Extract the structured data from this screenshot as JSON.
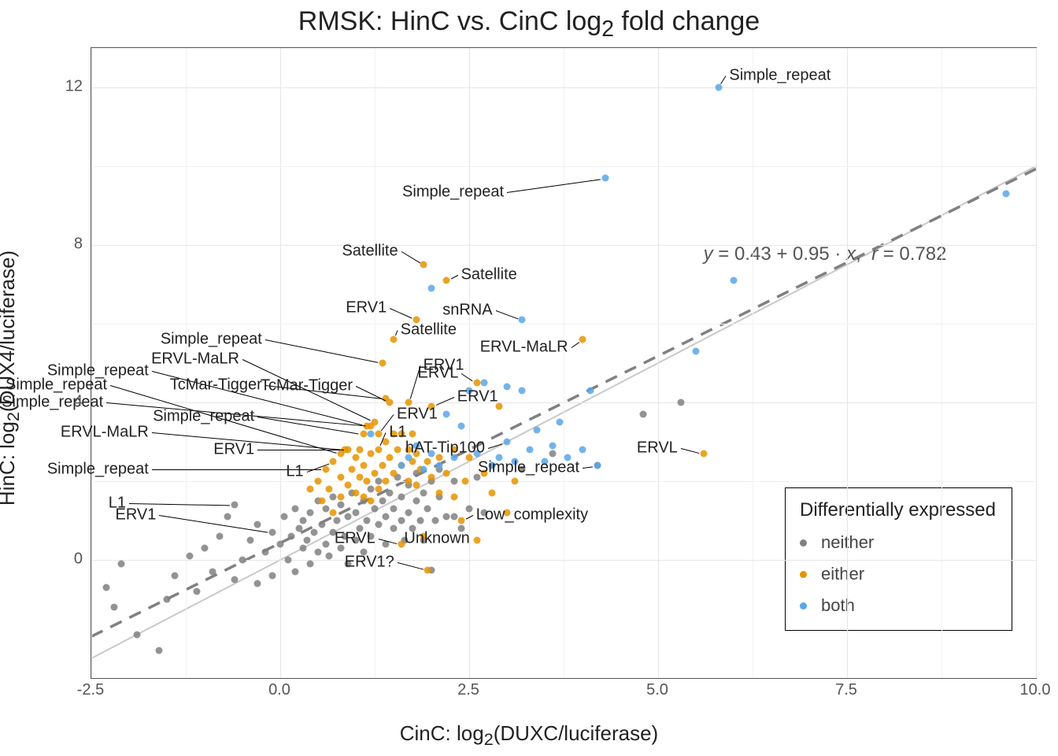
{
  "chart_data": {
    "type": "scatter",
    "title": "RMSK: HinC vs. CinC log2 fold change",
    "xlabel": "CinC: log2(DUXC/luciferase)",
    "ylabel": "HinC: log2(DUX4/luciferase)",
    "xlim": [
      -2.5,
      10.0
    ],
    "ylim": [
      -3.0,
      13.0
    ],
    "x_ticks": [
      -2.5,
      0.0,
      2.5,
      5.0,
      7.5,
      10.0
    ],
    "y_ticks": [
      0,
      4,
      8,
      12
    ],
    "equation": "y = 0.43 + 0.95 · x,  r = 0.782",
    "legend_title": "Differentially expressed",
    "legend_items": [
      {
        "key": "neither",
        "label": "neither",
        "color": "#808080"
      },
      {
        "key": "either",
        "label": "either",
        "color": "#e59400"
      },
      {
        "key": "both",
        "label": "both",
        "color": "#5aa6e6"
      }
    ],
    "regression": {
      "intercept": 0.43,
      "slope": 0.95
    },
    "series": [
      {
        "name": "neither",
        "points": [
          {
            "x": -2.2,
            "y": -1.2
          },
          {
            "x": -2.3,
            "y": -0.7
          },
          {
            "x": -2.1,
            "y": -0.1
          },
          {
            "x": -1.9,
            "y": -1.9
          },
          {
            "x": -1.6,
            "y": -2.3
          },
          {
            "x": -1.5,
            "y": -1.0
          },
          {
            "x": -1.4,
            "y": -0.4
          },
          {
            "x": -1.2,
            "y": 0.1
          },
          {
            "x": -1.1,
            "y": -0.8
          },
          {
            "x": -1.0,
            "y": 0.3
          },
          {
            "x": -0.9,
            "y": -0.3
          },
          {
            "x": -0.8,
            "y": 0.6
          },
          {
            "x": -0.7,
            "y": 1.1
          },
          {
            "x": -0.6,
            "y": -0.5
          },
          {
            "x": -0.6,
            "y": 1.4
          },
          {
            "x": -0.5,
            "y": 0.0
          },
          {
            "x": -0.4,
            "y": 0.5
          },
          {
            "x": -0.3,
            "y": -0.6
          },
          {
            "x": -0.3,
            "y": 0.9
          },
          {
            "x": -0.2,
            "y": 0.2
          },
          {
            "x": -0.1,
            "y": 0.7
          },
          {
            "x": -0.1,
            "y": -0.4
          },
          {
            "x": 0.0,
            "y": 0.4
          },
          {
            "x": 0.05,
            "y": 1.1
          },
          {
            "x": 0.1,
            "y": 0.0
          },
          {
            "x": 0.15,
            "y": 0.6
          },
          {
            "x": 0.2,
            "y": 1.3
          },
          {
            "x": 0.2,
            "y": -0.3
          },
          {
            "x": 0.25,
            "y": 0.8
          },
          {
            "x": 0.3,
            "y": 0.3
          },
          {
            "x": 0.3,
            "y": 1.0
          },
          {
            "x": 0.35,
            "y": 0.5
          },
          {
            "x": 0.4,
            "y": 1.2
          },
          {
            "x": 0.4,
            "y": -0.1
          },
          {
            "x": 0.45,
            "y": 0.7
          },
          {
            "x": 0.5,
            "y": 1.5
          },
          {
            "x": 0.5,
            "y": 0.2
          },
          {
            "x": 0.55,
            "y": 0.9
          },
          {
            "x": 0.6,
            "y": 0.4
          },
          {
            "x": 0.6,
            "y": 1.3
          },
          {
            "x": 0.65,
            "y": 0.1
          },
          {
            "x": 0.7,
            "y": 0.7
          },
          {
            "x": 0.7,
            "y": 1.6
          },
          {
            "x": 0.75,
            "y": 1.0
          },
          {
            "x": 0.8,
            "y": 0.3
          },
          {
            "x": 0.8,
            "y": 1.4
          },
          {
            "x": 0.85,
            "y": 0.6
          },
          {
            "x": 0.9,
            "y": 1.1
          },
          {
            "x": 0.9,
            "y": -0.1
          },
          {
            "x": 0.95,
            "y": 1.7
          },
          {
            "x": 1.0,
            "y": 0.5
          },
          {
            "x": 1.0,
            "y": 1.2
          },
          {
            "x": 1.05,
            "y": 0.8
          },
          {
            "x": 1.1,
            "y": 1.5
          },
          {
            "x": 1.1,
            "y": 0.2
          },
          {
            "x": 1.15,
            "y": 1.0
          },
          {
            "x": 1.2,
            "y": 1.8
          },
          {
            "x": 1.2,
            "y": 0.6
          },
          {
            "x": 1.25,
            "y": 1.3
          },
          {
            "x": 1.3,
            "y": 0.9
          },
          {
            "x": 1.3,
            "y": 2.0
          },
          {
            "x": 1.35,
            "y": 1.5
          },
          {
            "x": 1.4,
            "y": 0.4
          },
          {
            "x": 1.4,
            "y": 1.1
          },
          {
            "x": 1.45,
            "y": 1.7
          },
          {
            "x": 1.5,
            "y": 1.3
          },
          {
            "x": 1.5,
            "y": 0.8
          },
          {
            "x": 1.55,
            "y": 2.1
          },
          {
            "x": 1.6,
            "y": 1.0
          },
          {
            "x": 1.6,
            "y": 1.6
          },
          {
            "x": 1.65,
            "y": 0.5
          },
          {
            "x": 1.7,
            "y": 1.9
          },
          {
            "x": 1.7,
            "y": 1.2
          },
          {
            "x": 1.75,
            "y": 0.8
          },
          {
            "x": 1.8,
            "y": 1.5
          },
          {
            "x": 1.8,
            "y": 2.2
          },
          {
            "x": 1.85,
            "y": 1.0
          },
          {
            "x": 1.9,
            "y": 1.7
          },
          {
            "x": 1.9,
            "y": 0.5
          },
          {
            "x": 1.95,
            "y": 1.3
          },
          {
            "x": 2.0,
            "y": 2.0
          },
          {
            "x": 2.0,
            "y": -0.25
          },
          {
            "x": 2.05,
            "y": 1.0
          },
          {
            "x": 2.1,
            "y": 1.6
          },
          {
            "x": 2.1,
            "y": 2.3
          },
          {
            "x": 2.2,
            "y": 1.1
          },
          {
            "x": 2.3,
            "y": 2.0
          },
          {
            "x": 2.3,
            "y": 1.1
          },
          {
            "x": 2.4,
            "y": 0.8
          },
          {
            "x": 2.5,
            "y": 1.3
          },
          {
            "x": 2.6,
            "y": 2.1
          },
          {
            "x": 2.7,
            "y": 1.2
          },
          {
            "x": 2.8,
            "y": 2.4
          },
          {
            "x": 3.2,
            "y": 2.3
          },
          {
            "x": 3.6,
            "y": 2.7
          },
          {
            "x": 4.2,
            "y": 2.4
          },
          {
            "x": 4.8,
            "y": 3.7
          },
          {
            "x": 5.3,
            "y": 4.0
          }
        ]
      },
      {
        "name": "either",
        "points": [
          {
            "x": 0.4,
            "y": 1.8
          },
          {
            "x": 0.5,
            "y": 2.0
          },
          {
            "x": 0.55,
            "y": 1.5
          },
          {
            "x": 0.6,
            "y": 2.3
          },
          {
            "x": 0.65,
            "y": 1.8
          },
          {
            "x": 0.7,
            "y": 2.5
          },
          {
            "x": 0.7,
            "y": 1.2
          },
          {
            "x": 0.8,
            "y": 2.7
          },
          {
            "x": 0.8,
            "y": 1.6
          },
          {
            "x": 0.8,
            "y": 2.1
          },
          {
            "x": 0.85,
            "y": 2.8
          },
          {
            "x": 0.9,
            "y": 1.9
          },
          {
            "x": 0.9,
            "y": 2.8
          },
          {
            "x": 0.95,
            "y": 2.3
          },
          {
            "x": 1.0,
            "y": 2.6
          },
          {
            "x": 1.0,
            "y": 1.7
          },
          {
            "x": 1.05,
            "y": 2.1
          },
          {
            "x": 1.05,
            "y": 2.8
          },
          {
            "x": 1.1,
            "y": 3.2
          },
          {
            "x": 1.1,
            "y": 2.4
          },
          {
            "x": 1.1,
            "y": 1.6
          },
          {
            "x": 1.15,
            "y": 3.4
          },
          {
            "x": 1.15,
            "y": 2.0
          },
          {
            "x": 1.2,
            "y": 2.7
          },
          {
            "x": 1.2,
            "y": 1.5
          },
          {
            "x": 1.2,
            "y": 3.4
          },
          {
            "x": 1.25,
            "y": 2.2
          },
          {
            "x": 1.25,
            "y": 3.5
          },
          {
            "x": 1.3,
            "y": 2.8
          },
          {
            "x": 1.3,
            "y": 1.8
          },
          {
            "x": 1.3,
            "y": 3.2
          },
          {
            "x": 1.35,
            "y": 2.4
          },
          {
            "x": 1.35,
            "y": 5.0
          },
          {
            "x": 1.4,
            "y": 3.0
          },
          {
            "x": 1.4,
            "y": 2.0
          },
          {
            "x": 1.4,
            "y": 4.1
          },
          {
            "x": 1.45,
            "y": 2.6
          },
          {
            "x": 1.45,
            "y": 4.0
          },
          {
            "x": 1.5,
            "y": 3.2
          },
          {
            "x": 1.5,
            "y": 2.2
          },
          {
            "x": 1.5,
            "y": 5.6
          },
          {
            "x": 1.55,
            "y": 2.8
          },
          {
            "x": 1.6,
            "y": 2.4
          },
          {
            "x": 1.6,
            "y": 3.2
          },
          {
            "x": 1.6,
            "y": 0.4
          },
          {
            "x": 1.7,
            "y": 2.8
          },
          {
            "x": 1.7,
            "y": 2.0
          },
          {
            "x": 1.7,
            "y": 4.0
          },
          {
            "x": 1.75,
            "y": 2.5
          },
          {
            "x": 1.75,
            "y": 3.2
          },
          {
            "x": 1.8,
            "y": 2.7
          },
          {
            "x": 1.8,
            "y": 1.9
          },
          {
            "x": 1.8,
            "y": 6.1
          },
          {
            "x": 1.85,
            "y": 2.3
          },
          {
            "x": 1.9,
            "y": 0.6
          },
          {
            "x": 1.9,
            "y": 7.5
          },
          {
            "x": 1.95,
            "y": 2.5
          },
          {
            "x": 1.95,
            "y": -0.25
          },
          {
            "x": 2.0,
            "y": 2.1
          },
          {
            "x": 2.0,
            "y": 3.9
          },
          {
            "x": 2.1,
            "y": 2.6
          },
          {
            "x": 2.1,
            "y": 1.7
          },
          {
            "x": 2.2,
            "y": 2.2
          },
          {
            "x": 2.2,
            "y": 7.1
          },
          {
            "x": 2.3,
            "y": 2.8
          },
          {
            "x": 2.3,
            "y": 1.6
          },
          {
            "x": 2.4,
            "y": 1.0
          },
          {
            "x": 2.45,
            "y": 2.0
          },
          {
            "x": 2.5,
            "y": 2.6
          },
          {
            "x": 2.6,
            "y": 0.5
          },
          {
            "x": 2.6,
            "y": 4.5
          },
          {
            "x": 2.7,
            "y": 2.2
          },
          {
            "x": 2.8,
            "y": 1.7
          },
          {
            "x": 2.9,
            "y": 3.9
          },
          {
            "x": 3.0,
            "y": 1.2
          },
          {
            "x": 3.1,
            "y": 2.0
          },
          {
            "x": 4.0,
            "y": 5.6
          },
          {
            "x": 5.6,
            "y": 2.7
          }
        ]
      },
      {
        "name": "both",
        "points": [
          {
            "x": 1.2,
            "y": 3.2
          },
          {
            "x": 1.6,
            "y": 2.4
          },
          {
            "x": 1.7,
            "y": 2.6
          },
          {
            "x": 1.8,
            "y": 2.9
          },
          {
            "x": 1.9,
            "y": 2.3
          },
          {
            "x": 2.0,
            "y": 2.7
          },
          {
            "x": 2.0,
            "y": 6.9
          },
          {
            "x": 2.1,
            "y": 2.4
          },
          {
            "x": 2.2,
            "y": 3.7
          },
          {
            "x": 2.3,
            "y": 2.6
          },
          {
            "x": 2.4,
            "y": 3.4
          },
          {
            "x": 2.5,
            "y": 4.3
          },
          {
            "x": 2.6,
            "y": 2.7
          },
          {
            "x": 2.7,
            "y": 4.5
          },
          {
            "x": 2.8,
            "y": 2.4
          },
          {
            "x": 2.9,
            "y": 2.6
          },
          {
            "x": 3.0,
            "y": 3.0
          },
          {
            "x": 3.0,
            "y": 4.4
          },
          {
            "x": 3.1,
            "y": 2.5
          },
          {
            "x": 3.2,
            "y": 4.3
          },
          {
            "x": 3.2,
            "y": 6.1
          },
          {
            "x": 3.3,
            "y": 2.8
          },
          {
            "x": 3.4,
            "y": 3.3
          },
          {
            "x": 3.5,
            "y": 2.5
          },
          {
            "x": 3.6,
            "y": 2.9
          },
          {
            "x": 3.7,
            "y": 3.5
          },
          {
            "x": 3.8,
            "y": 2.6
          },
          {
            "x": 4.0,
            "y": 2.8
          },
          {
            "x": 4.1,
            "y": 4.3
          },
          {
            "x": 4.2,
            "y": 2.4
          },
          {
            "x": 4.3,
            "y": 9.7
          },
          {
            "x": 5.5,
            "y": 5.3
          },
          {
            "x": 5.8,
            "y": 12.0
          },
          {
            "x": 6.0,
            "y": 7.1
          },
          {
            "x": 9.6,
            "y": 9.3
          }
        ]
      }
    ],
    "annotations": [
      {
        "label": "Simple_repeat",
        "x": 5.8,
        "y": 12.0,
        "lx": 5.9,
        "ly": 12.3
      },
      {
        "label": "Simple_repeat",
        "x": 4.3,
        "y": 9.7,
        "lx": 3.0,
        "ly": 9.35
      },
      {
        "label": "Satellite",
        "x": 1.9,
        "y": 7.5,
        "lx": 1.6,
        "ly": 7.85
      },
      {
        "label": "Satellite",
        "x": 2.2,
        "y": 7.1,
        "lx": 2.35,
        "ly": 7.25
      },
      {
        "label": "ERV1",
        "x": 1.8,
        "y": 6.1,
        "lx": 1.45,
        "ly": 6.4
      },
      {
        "label": "snRNA",
        "x": 3.2,
        "y": 6.1,
        "lx": 2.85,
        "ly": 6.35
      },
      {
        "label": "Satellite",
        "x": 1.5,
        "y": 5.6,
        "lx": 1.55,
        "ly": 5.85
      },
      {
        "label": "Simple_repeat",
        "x": 1.35,
        "y": 5.0,
        "lx": -0.2,
        "ly": 5.6
      },
      {
        "label": "ERVL-MaLR",
        "x": 1.25,
        "y": 3.5,
        "lx": -0.5,
        "ly": 5.1
      },
      {
        "label": "Simple_repeat",
        "x": 1.15,
        "y": 3.4,
        "lx": -1.7,
        "ly": 4.8
      },
      {
        "label": "TcMar-Tigger",
        "x": 1.4,
        "y": 4.1,
        "lx": -0.2,
        "ly": 4.45
      },
      {
        "label": "Simple_repeat",
        "x": 0.8,
        "y": 2.7,
        "lx": -2.25,
        "ly": 4.45
      },
      {
        "label": "TcMar-Tigger",
        "x": 1.45,
        "y": 4.0,
        "lx": 1.0,
        "ly": 4.42
      },
      {
        "label": "ERVL",
        "x": 2.6,
        "y": 4.5,
        "lx": 2.4,
        "ly": 4.75
      },
      {
        "label": "ERV1",
        "x": 1.7,
        "y": 4.0,
        "lx": 1.85,
        "ly": 4.95
      },
      {
        "label": "Simple_repeat",
        "x": 1.2,
        "y": 3.4,
        "lx": -2.3,
        "ly": 4.0
      },
      {
        "label": "Simple_repeat",
        "x": 1.1,
        "y": 3.2,
        "lx": -0.3,
        "ly": 3.65
      },
      {
        "label": "ERV1",
        "x": 2.0,
        "y": 3.9,
        "lx": 2.3,
        "ly": 4.15
      },
      {
        "label": "ERV1",
        "x": 1.3,
        "y": 3.2,
        "lx": 1.5,
        "ly": 3.7
      },
      {
        "label": "ERVL-MaLR",
        "x": 0.9,
        "y": 2.8,
        "lx": -1.7,
        "ly": 3.25
      },
      {
        "label": "ERV1",
        "x": 0.85,
        "y": 2.8,
        "lx": -0.3,
        "ly": 2.8
      },
      {
        "label": "L1",
        "x": 1.3,
        "y": 2.8,
        "lx": 1.4,
        "ly": 3.25
      },
      {
        "label": "hAT-Tip100",
        "x": 3.0,
        "y": 3.0,
        "lx": 2.75,
        "ly": 2.85
      },
      {
        "label": "ERVL-MaLR",
        "x": 4.0,
        "y": 5.6,
        "lx": 3.85,
        "ly": 5.4
      },
      {
        "label": "ERVL",
        "x": 5.6,
        "y": 2.7,
        "lx": 5.3,
        "ly": 2.85
      },
      {
        "label": "Simple_repeat",
        "x": 4.2,
        "y": 2.4,
        "lx": 4.0,
        "ly": 2.35
      },
      {
        "label": "Simple_repeat",
        "x": 0.6,
        "y": 2.3,
        "lx": -1.7,
        "ly": 2.3
      },
      {
        "label": "L1",
        "x": 0.7,
        "y": 2.5,
        "lx": 0.35,
        "ly": 2.25
      },
      {
        "label": "L1",
        "x": -0.6,
        "y": 1.4,
        "lx": -2.0,
        "ly": 1.45
      },
      {
        "label": "ERV1",
        "x": -0.1,
        "y": 0.7,
        "lx": -1.6,
        "ly": 1.15
      },
      {
        "label": "Low_complexity",
        "x": 2.4,
        "y": 1.0,
        "lx": 2.55,
        "ly": 1.15
      },
      {
        "label": "ERVL",
        "x": 1.6,
        "y": 0.4,
        "lx": 1.3,
        "ly": 0.55
      },
      {
        "label": "Unknown",
        "x": 2.6,
        "y": 0.5,
        "lx": 2.55,
        "ly": 0.55
      },
      {
        "label": "ERV1?",
        "x": 1.95,
        "y": -0.25,
        "lx": 1.55,
        "ly": -0.05
      }
    ]
  }
}
